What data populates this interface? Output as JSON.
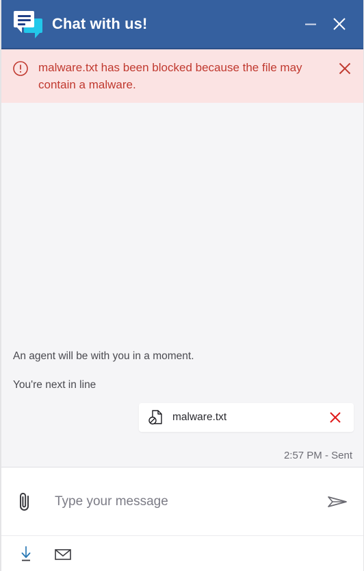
{
  "window": {
    "title": "Chat with us!",
    "brand_icon": "chat-bubbles-icon",
    "minimize_label": "Minimize",
    "close_label": "Close",
    "header_color": "#35609f",
    "accent_cyan": "#22c8ea"
  },
  "alert": {
    "icon": "exclamation-circle-icon",
    "message": "malware.txt has been blocked because the file may contain a malware.",
    "close_icon": "close-icon",
    "background_color": "#fbe3e3",
    "text_color": "#c0392f"
  },
  "conversation": {
    "messages": [
      {
        "text": "An agent will be with you in a moment."
      },
      {
        "text": "You're next in line"
      }
    ],
    "attachment": {
      "icon": "blocked-file-icon",
      "filename": "malware.txt",
      "remove_icon": "close-icon",
      "remove_color": "#e01b1b"
    },
    "status": "2:57 PM - Sent"
  },
  "composer": {
    "attach_icon": "paperclip-icon",
    "input_value": "",
    "input_placeholder": "Type your message",
    "send_icon": "send-paper-plane-icon"
  },
  "bottom_bar": {
    "download_icon": "download-icon",
    "download_color": "#2a79b5",
    "email_icon": "envelope-icon",
    "email_color": "#3a3a3f"
  }
}
